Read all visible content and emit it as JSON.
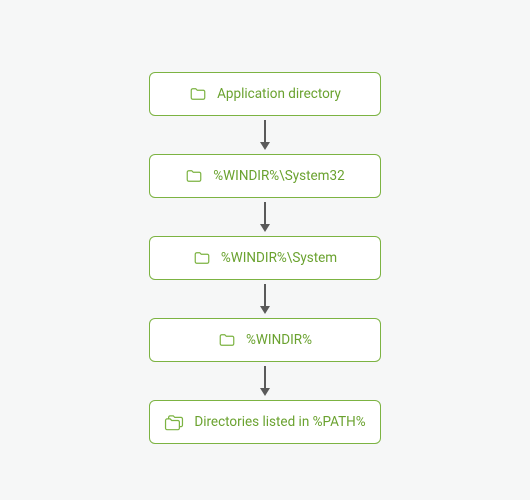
{
  "colors": {
    "node_border": "#7cb342",
    "node_text": "#6aa22f",
    "node_bg": "#ffffff",
    "arrow": "#5a5a5a",
    "page_bg": "#f6f7f7"
  },
  "diagram": {
    "nodes": [
      {
        "label": "Application directory",
        "icon": "folder-icon"
      },
      {
        "label": "%WINDIR%\\System32",
        "icon": "folder-icon"
      },
      {
        "label": "%WINDIR%\\System",
        "icon": "folder-icon"
      },
      {
        "label": "%WINDIR%",
        "icon": "folder-icon"
      },
      {
        "label": "Directories listed in %PATH%",
        "icon": "folders-icon"
      }
    ]
  }
}
